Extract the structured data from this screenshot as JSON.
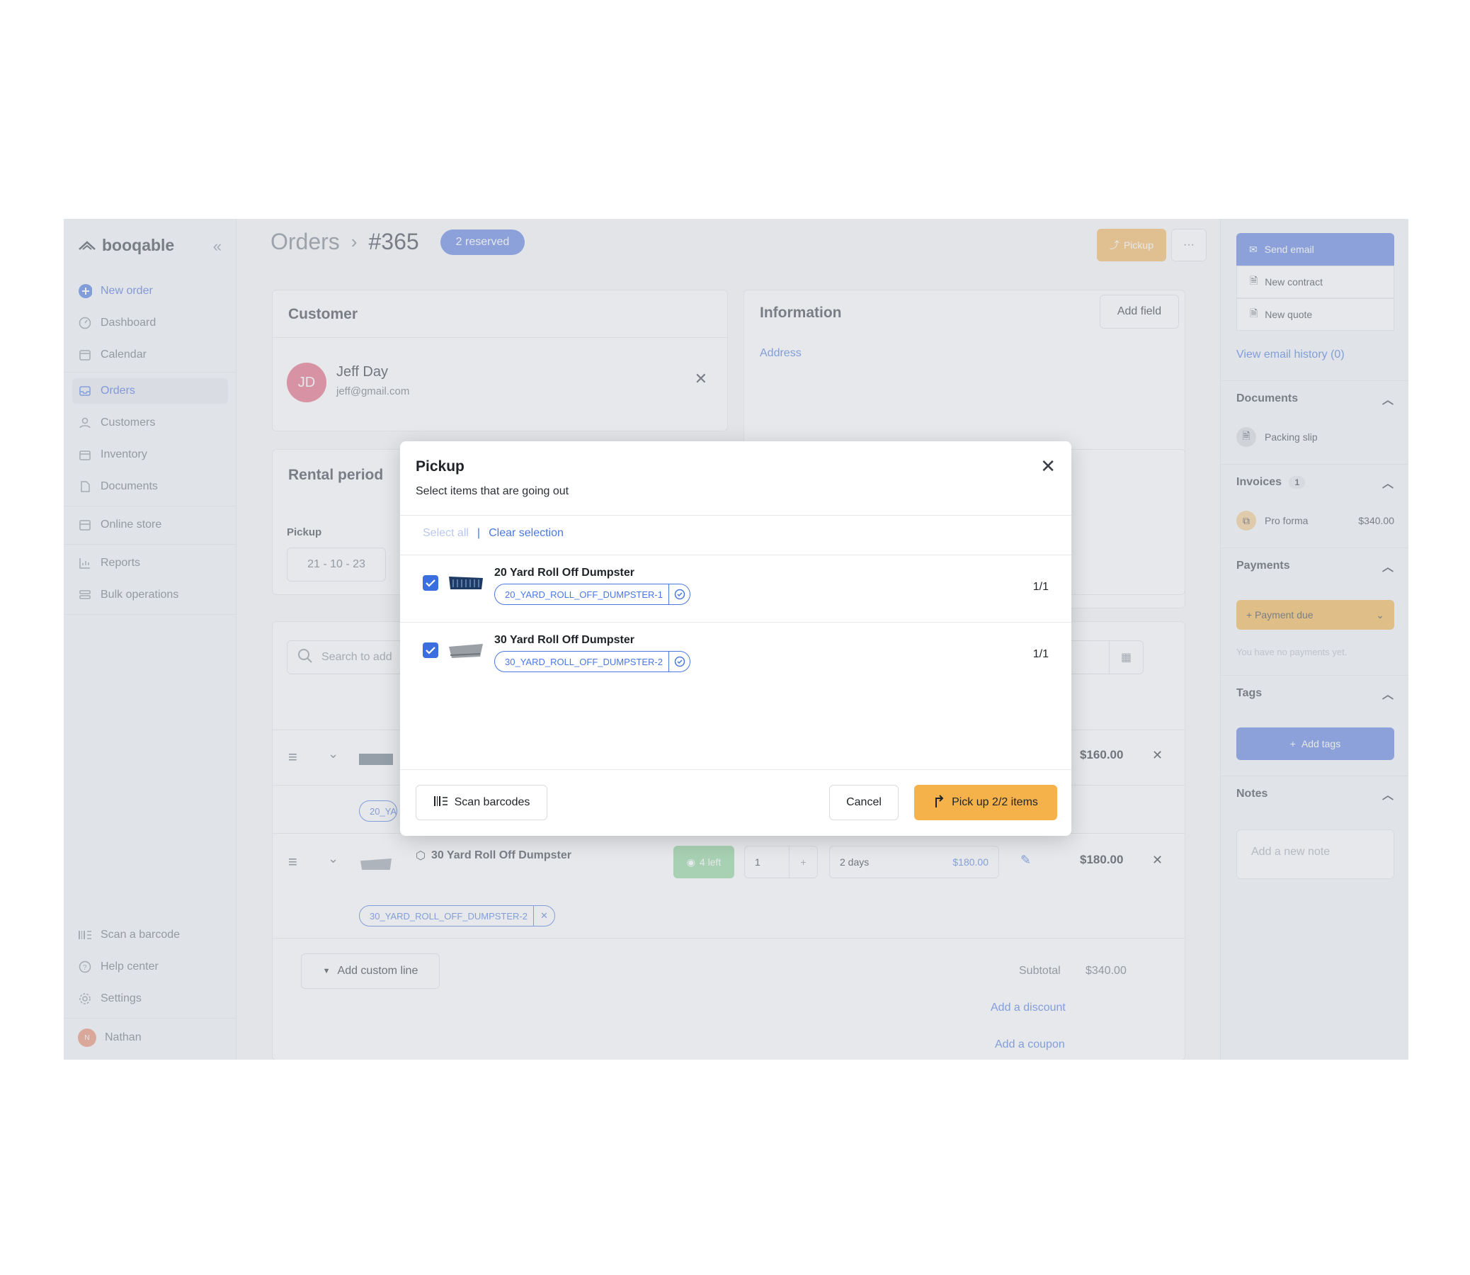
{
  "sidebar": {
    "logo": "booqable",
    "items": [
      {
        "label": "New order"
      },
      {
        "label": "Dashboard"
      },
      {
        "label": "Calendar"
      },
      {
        "label": "Orders"
      },
      {
        "label": "Customers"
      },
      {
        "label": "Inventory"
      },
      {
        "label": "Documents"
      },
      {
        "label": "Online store"
      },
      {
        "label": "Reports"
      },
      {
        "label": "Bulk operations"
      }
    ],
    "bottom": [
      {
        "label": "Scan a barcode"
      },
      {
        "label": "Help center"
      },
      {
        "label": "Settings"
      }
    ],
    "user": {
      "initial": "N",
      "name": "Nathan"
    }
  },
  "header": {
    "section": "Orders",
    "order_number": "#365",
    "status_badge": "2 reserved",
    "pickup_label": "Pickup",
    "more_label": "···"
  },
  "customer": {
    "title": "Customer",
    "initials": "JD",
    "name": "Jeff Day",
    "email": "jeff@gmail.com"
  },
  "information": {
    "title": "Information",
    "add_field": "Add field",
    "address_label": "Address"
  },
  "rental_period": {
    "title": "Rental period",
    "pickup_label": "Pickup",
    "pickup_date": "21 - 10 - 23"
  },
  "lines": {
    "search_placeholder": "Search to add",
    "rows": [
      {
        "tag_partial": "20_YA",
        "price": "$160.00"
      },
      {
        "name": "30 Yard Roll Off Dumpster",
        "availability": "4 left",
        "quantity": "1",
        "duration": "2 days",
        "unit_price": "$180.00",
        "price": "$180.00",
        "tag": "30_YARD_ROLL_OFF_DUMPSTER-2"
      }
    ],
    "add_custom_line": "Add custom line",
    "subtotal_label": "Subtotal",
    "subtotal_value": "$340.00",
    "add_discount": "Add a discount",
    "add_coupon": "Add a coupon"
  },
  "right_panel": {
    "send_email": "Send email",
    "new_contract": "New contract",
    "new_quote": "New quote",
    "email_history": "View email history (0)",
    "documents_title": "Documents",
    "packing_slip": "Packing slip",
    "invoices_title": "Invoices",
    "invoices_count": "1",
    "pro_forma": "Pro forma",
    "pro_forma_amount": "$340.00",
    "payments_title": "Payments",
    "payment_due": "Payment due",
    "no_payments": "You have no payments yet.",
    "tags_title": "Tags",
    "add_tags": "Add tags",
    "notes_title": "Notes",
    "note_placeholder": "Add a new note"
  },
  "modal": {
    "title": "Pickup",
    "subtitle": "Select items that are going out",
    "select_all": "Select all",
    "separator": "|",
    "clear_selection": "Clear selection",
    "items": [
      {
        "name": "20 Yard Roll Off Dumpster",
        "tag": "20_YARD_ROLL_OFF_DUMPSTER-1",
        "quantity": "1/1",
        "checked": true
      },
      {
        "name": "30 Yard Roll Off Dumpster",
        "tag": "30_YARD_ROLL_OFF_DUMPSTER-2",
        "quantity": "1/1",
        "checked": true
      }
    ],
    "scan_barcodes": "Scan barcodes",
    "cancel": "Cancel",
    "confirm": "Pick up 2/2 items"
  },
  "colors": {
    "accent": "#4a78e0",
    "primary_action": "#f5b24a",
    "checkbox": "#3b6fe0",
    "avatar": "#e3637d"
  }
}
